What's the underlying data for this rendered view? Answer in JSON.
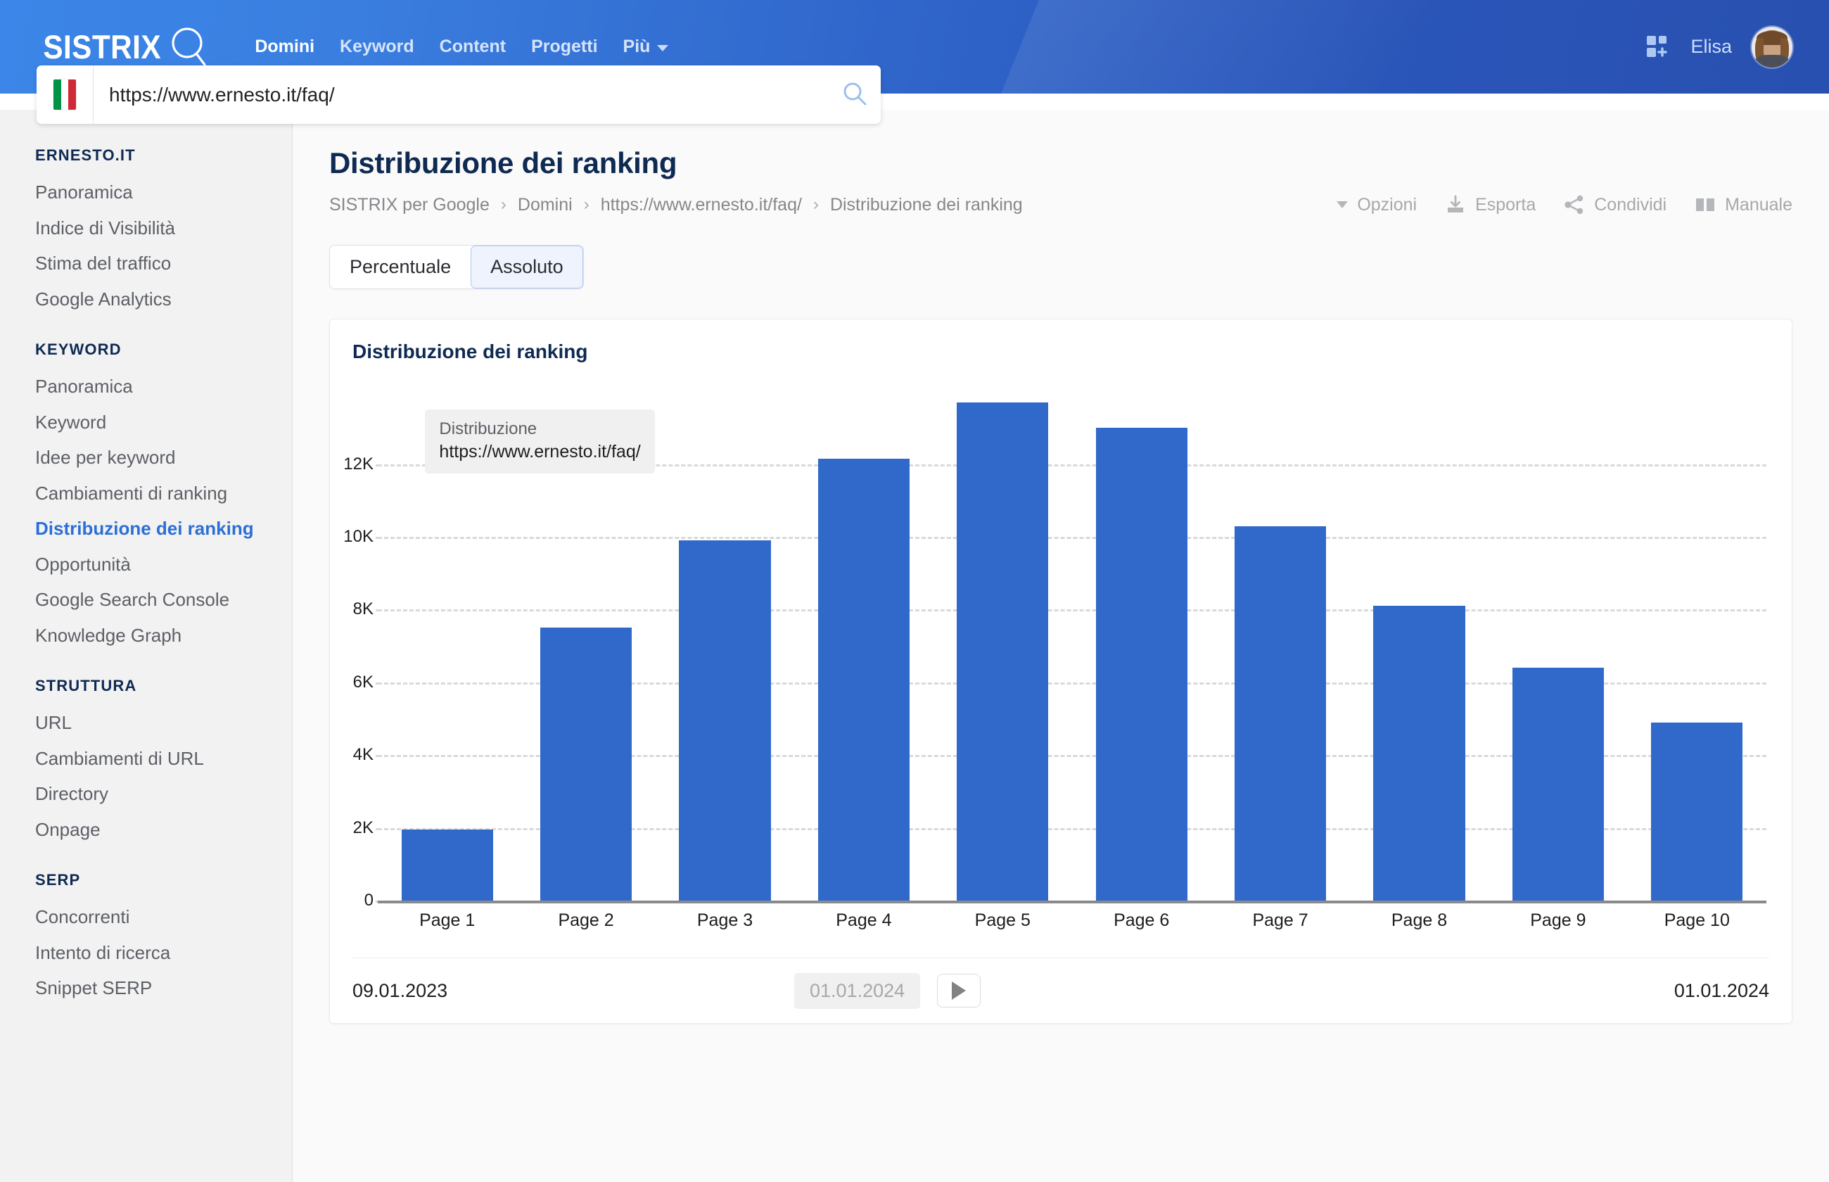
{
  "header": {
    "brand": "SISTRIX",
    "brand_icon": "magnifier-icon",
    "nav": [
      {
        "label": "Domini",
        "active": true,
        "caret": false
      },
      {
        "label": "Keyword",
        "active": false,
        "caret": false
      },
      {
        "label": "Content",
        "active": false,
        "caret": false
      },
      {
        "label": "Progetti",
        "active": false,
        "caret": false
      },
      {
        "label": "Più",
        "active": false,
        "caret": true
      }
    ],
    "apps_icon": "apps-add-icon",
    "user_name": "Elisa",
    "avatar_icon": "user-avatar"
  },
  "search": {
    "country_flag": "italy-flag",
    "value": "https://www.ernesto.it/faq/",
    "placeholder": "https://www.ernesto.it/faq/",
    "search_icon": "search-icon"
  },
  "sidebar": {
    "groups": [
      {
        "heading": "ERNESTO.IT",
        "items": [
          {
            "label": "Panoramica",
            "active": false
          },
          {
            "label": "Indice di Visibilità",
            "active": false
          },
          {
            "label": "Stima del traffico",
            "active": false
          },
          {
            "label": "Google Analytics",
            "active": false
          }
        ]
      },
      {
        "heading": "KEYWORD",
        "items": [
          {
            "label": "Panoramica",
            "active": false
          },
          {
            "label": "Keyword",
            "active": false
          },
          {
            "label": "Idee per keyword",
            "active": false
          },
          {
            "label": "Cambiamenti di ranking",
            "active": false
          },
          {
            "label": "Distribuzione dei ranking",
            "active": true
          },
          {
            "label": "Opportunità",
            "active": false
          },
          {
            "label": "Google Search Console",
            "active": false
          },
          {
            "label": "Knowledge Graph",
            "active": false
          }
        ]
      },
      {
        "heading": "STRUTTURA",
        "items": [
          {
            "label": "URL",
            "active": false
          },
          {
            "label": "Cambiamenti di URL",
            "active": false
          },
          {
            "label": "Directory",
            "active": false
          },
          {
            "label": "Onpage",
            "active": false
          }
        ]
      },
      {
        "heading": "SERP",
        "items": [
          {
            "label": "Concorrenti",
            "active": false
          },
          {
            "label": "Intento di ricerca",
            "active": false
          },
          {
            "label": "Snippet SERP",
            "active": false
          }
        ]
      }
    ]
  },
  "main": {
    "page_title": "Distribuzione dei ranking",
    "breadcrumb": [
      "SISTRIX per Google",
      "Domini",
      "https://www.ernesto.it/faq/",
      "Distribuzione dei ranking"
    ],
    "breadcrumb_separator": "›",
    "toolbar": [
      {
        "label": "Opzioni",
        "icon": "chevron-down-icon"
      },
      {
        "label": "Esporta",
        "icon": "download-icon"
      },
      {
        "label": "Condividi",
        "icon": "share-icon"
      },
      {
        "label": "Manuale",
        "icon": "book-icon"
      }
    ],
    "tabs": [
      {
        "label": "Percentuale",
        "selected": false
      },
      {
        "label": "Assoluto",
        "selected": true
      }
    ],
    "card_title": "Distribuzione dei ranking",
    "tooltip": {
      "title": "Distribuzione",
      "url": "https://www.ernesto.it/faq/"
    },
    "timeline": {
      "start_date": "09.01.2023",
      "current_date": "01.01.2024",
      "end_date": "01.01.2024",
      "play_icon": "play-icon"
    }
  },
  "colors": {
    "bar": "#3069c9",
    "accent": "#2b6fd6",
    "header_blue": "#2f63c8",
    "title_navy": "#0f2a52"
  },
  "chart_data": {
    "type": "bar",
    "title": "Distribuzione dei ranking",
    "xlabel": "",
    "ylabel": "",
    "categories": [
      "Page 1",
      "Page 2",
      "Page 3",
      "Page 4",
      "Page 5",
      "Page 6",
      "Page 7",
      "Page 8",
      "Page 9",
      "Page 10"
    ],
    "values": [
      1950,
      7500,
      9900,
      12150,
      13700,
      13000,
      10300,
      8100,
      6400,
      4900
    ],
    "ylim": [
      0,
      14200
    ],
    "yticks": [
      0,
      2000,
      4000,
      6000,
      8000,
      10000,
      12000
    ],
    "ytick_labels": [
      "0",
      "2K",
      "4K",
      "6K",
      "8K",
      "10K",
      "12K"
    ],
    "grid": true,
    "legend": "none",
    "series": [
      {
        "name": "Distribuzione",
        "values": [
          1950,
          7500,
          9900,
          12150,
          13700,
          13000,
          10300,
          8100,
          6400,
          4900
        ]
      }
    ]
  }
}
